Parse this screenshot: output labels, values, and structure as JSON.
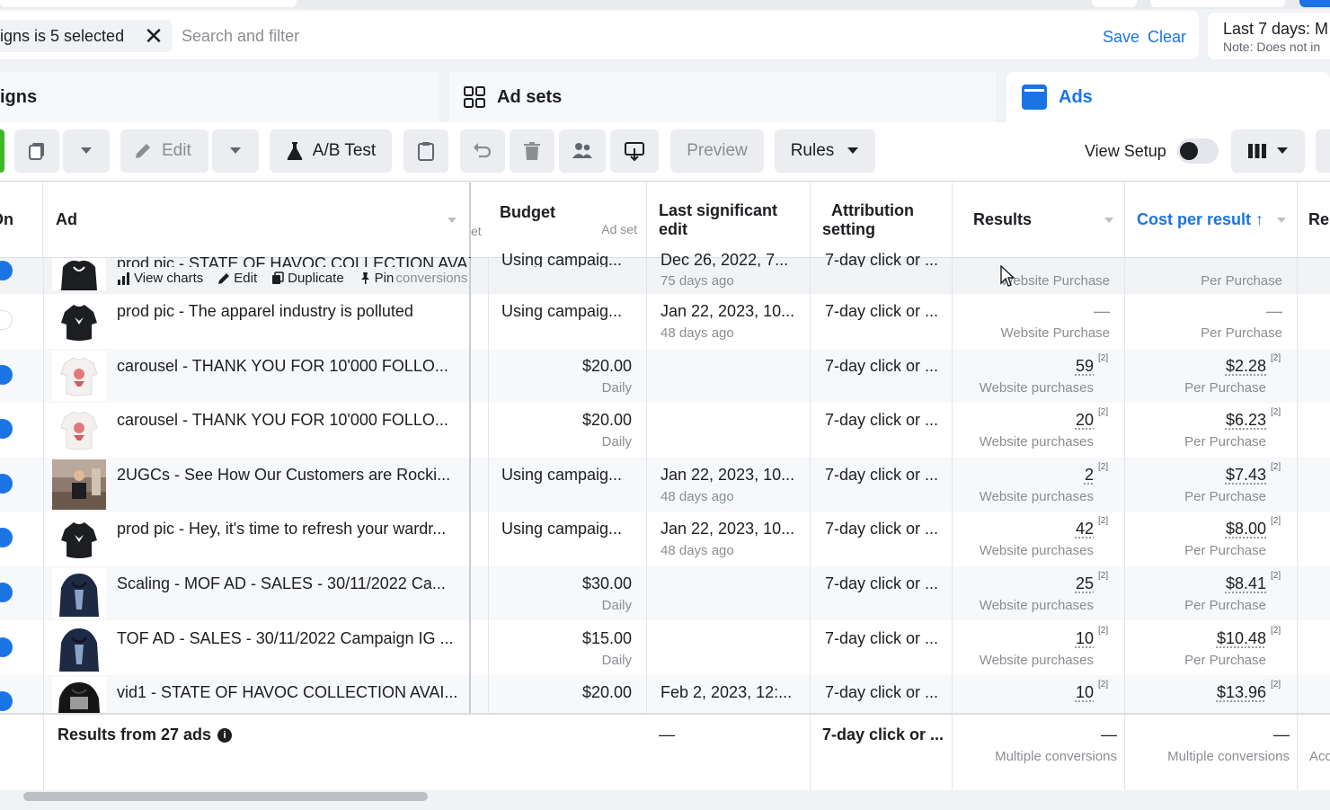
{
  "filter": {
    "chip_label": "igns is 5 selected",
    "chip_close": "✕",
    "search_placeholder": "Search and filter",
    "save": "Save",
    "clear": "Clear"
  },
  "date_range": {
    "label": "Last 7 days: M",
    "note": "Note: Does not in"
  },
  "tabs": {
    "campaigns": "igns",
    "adsets": "Ad sets",
    "ads": "Ads"
  },
  "toolbar": {
    "edit": "Edit",
    "ab_test": "A/B Test",
    "preview": "Preview",
    "rules": "Rules",
    "view_setup": "View Setup"
  },
  "columns": {
    "on": "On",
    "ad": "Ad",
    "ad_set_hint": "et",
    "budget": "Budget",
    "budget_sub": "Ad set",
    "last_edit_1": "Last significant",
    "last_edit_2": "edit",
    "attribution_1": "Attribution",
    "attribution_2": "setting",
    "results": "Results",
    "cost": "Cost per result ↑",
    "reach": "Re"
  },
  "first_row": {
    "name": "prod pic - STATE OF HAVOC COLLECTION AVAI...",
    "actions": [
      "View charts",
      "Edit",
      "Duplicate",
      "Pin"
    ],
    "overlay": "conversions",
    "budget": "Using campaig...",
    "edit": "Dec 26, 2022, 7...",
    "edit_sub": "75 days ago",
    "attribution": "7-day click or ...",
    "results_sub": "Website Purchase",
    "cost_sub": "Per Purchase"
  },
  "rows": [
    {
      "name": "prod pic - The apparel industry is polluted",
      "budget": "Using campaig...",
      "budget_sub": "",
      "edit": "Jan 22, 2023, 10...",
      "edit_sub": "48 days ago",
      "attribution": "7-day click or ...",
      "results": "—",
      "results_sub": "Website Purchase",
      "cost": "—",
      "cost_sub": "Per Purchase",
      "thumb": "black-tee",
      "active": false
    },
    {
      "name": "carousel - THANK YOU FOR 10'000 FOLLO...",
      "budget": "$20.00",
      "budget_sub": "Daily",
      "edit": "",
      "edit_sub": "",
      "attribution": "7-day click or ...",
      "results": "59",
      "results_sub": "Website purchases",
      "cost": "$2.28",
      "cost_sub": "Per Purchase",
      "thumb": "white-tee",
      "active": true
    },
    {
      "name": "carousel - THANK YOU FOR 10'000 FOLLO...",
      "budget": "$20.00",
      "budget_sub": "Daily",
      "edit": "",
      "edit_sub": "",
      "attribution": "7-day click or ...",
      "results": "20",
      "results_sub": "Website purchases",
      "cost": "$6.23",
      "cost_sub": "Per Purchase",
      "thumb": "white-tee",
      "active": true
    },
    {
      "name": "2UGCs - See How Our Customers are Rocki...",
      "budget": "Using campaig...",
      "budget_sub": "",
      "edit": "Jan 22, 2023, 10...",
      "edit_sub": "48 days ago",
      "attribution": "7-day click or ...",
      "results": "2",
      "results_sub": "Website purchases",
      "cost": "$7.43",
      "cost_sub": "Per Purchase",
      "thumb": "photo",
      "active": true
    },
    {
      "name": "prod pic - Hey, it's time to refresh your wardr...",
      "budget": "Using campaig...",
      "budget_sub": "",
      "edit": "Jan 22, 2023, 10...",
      "edit_sub": "48 days ago",
      "attribution": "7-day click or ...",
      "results": "42",
      "results_sub": "Website purchases",
      "cost": "$8.00",
      "cost_sub": "Per Purchase",
      "thumb": "black-tee",
      "active": true
    },
    {
      "name": "Scaling - MOF AD - SALES - 30/11/2022 Ca...",
      "budget": "$30.00",
      "budget_sub": "Daily",
      "edit": "",
      "edit_sub": "",
      "attribution": "7-day click or ...",
      "results": "25",
      "results_sub": "Website purchases",
      "cost": "$8.41",
      "cost_sub": "Per Purchase",
      "thumb": "hoodie",
      "active": true
    },
    {
      "name": "TOF AD - SALES - 30/11/2022 Campaign IG ...",
      "budget": "$15.00",
      "budget_sub": "Daily",
      "edit": "",
      "edit_sub": "",
      "attribution": "7-day click or ...",
      "results": "10",
      "results_sub": "Website purchases",
      "cost": "$10.48",
      "cost_sub": "Per Purchase",
      "thumb": "hoodie",
      "active": true
    },
    {
      "name": "vid1 - STATE OF HAVOC COLLECTION AVAI...",
      "budget": "$20.00",
      "budget_sub": "",
      "edit": "Feb 2, 2023, 12:...",
      "edit_sub": "",
      "attribution": "7-day click or ...",
      "results": "10",
      "results_sub": "",
      "cost": "$13.96",
      "cost_sub": "",
      "thumb": "black-hoodie",
      "active": true
    }
  ],
  "footer": {
    "label": "Results from 27 ads",
    "budget": "—",
    "attribution": "7-day click or ...",
    "results": "—",
    "results_sub": "Multiple conversions",
    "cost": "—",
    "cost_sub": "Multiple conversions",
    "reach_sub": "Acc"
  },
  "colors": {
    "accent": "#1b74e4",
    "muted": "#8a8d91"
  }
}
